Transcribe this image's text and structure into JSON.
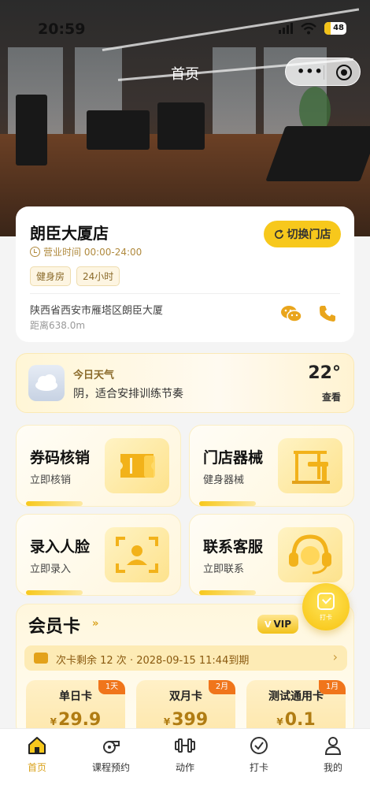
{
  "status_bar": {
    "time": "20:59",
    "battery": "48"
  },
  "nav": {
    "title": "首页"
  },
  "store": {
    "name": "朗臣大厦店",
    "hours": "营业时间 00:00-24:00",
    "switch_label": "切换门店",
    "tags": [
      "健身房",
      "24小时"
    ],
    "address": "陕西省西安市雁塔区朗臣大厦",
    "distance": "距离638.0m"
  },
  "weather": {
    "title": "今日天气",
    "desc": "阴，适合安排训练节奏",
    "temp": "22°",
    "action": "查看"
  },
  "features": [
    {
      "title": "券码核销",
      "sub": "立即核销",
      "icon": "ticket-icon"
    },
    {
      "title": "门店器械",
      "sub": "健身器械",
      "icon": "equipment-icon"
    },
    {
      "title": "录入人脸",
      "sub": "立即录入",
      "icon": "face-scan-icon"
    },
    {
      "title": "联系客服",
      "sub": "立即联系",
      "icon": "headset-icon"
    }
  ],
  "member": {
    "title": "会员卡",
    "vip_label": "VIP",
    "vip_mark": "V",
    "remaining": "次卡剩余 12 次 · 2028-09-15 11:44到期",
    "cards": [
      {
        "name": "单日卡",
        "currency": "¥",
        "price": "29.9",
        "badge": "1天"
      },
      {
        "name": "双月卡",
        "currency": "¥",
        "price": "399",
        "badge": "2月"
      },
      {
        "name": "测试通用卡",
        "currency": "¥",
        "price": "0.1",
        "badge": "1月"
      }
    ]
  },
  "float_checkin": {
    "label": "打卡"
  },
  "tabbar": {
    "active": "首页",
    "items": [
      {
        "label": "首页",
        "icon": "home-icon"
      },
      {
        "label": "课程预约",
        "icon": "whistle-icon"
      },
      {
        "label": "动作",
        "icon": "dumbbell-icon"
      },
      {
        "label": "打卡",
        "icon": "check-circle-icon"
      },
      {
        "label": "我的",
        "icon": "user-icon"
      }
    ]
  },
  "colors": {
    "accent": "#f7c81c",
    "accent_text": "#d9a21b",
    "badge": "#f0751b"
  }
}
